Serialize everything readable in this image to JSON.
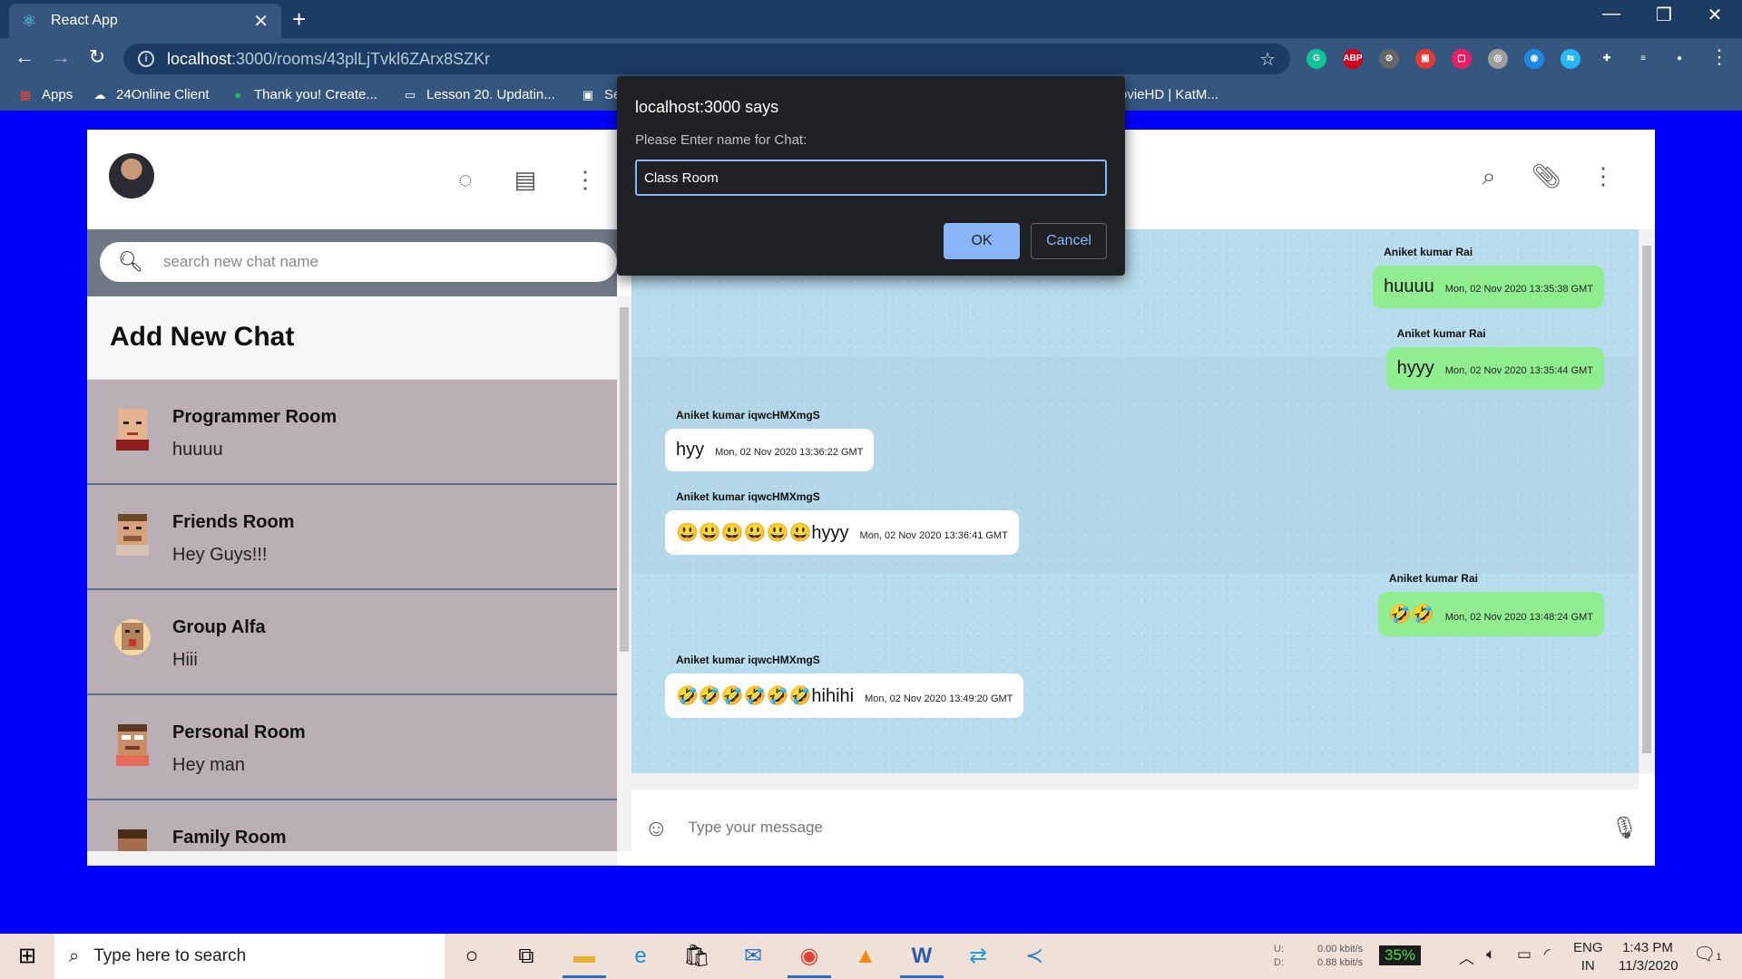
{
  "browser": {
    "tab_title": "React App",
    "url_host": "localhost",
    "url_path": ":3000/rooms/43plLjTvkl6ZArx8SZKr",
    "extensions": [
      "grammarly-icon",
      "adblock-icon",
      "blocker-icon",
      "extension-red-icon",
      "extension-pink-icon",
      "extension-gray-icon",
      "extension-blue-icon",
      "translate-icon",
      "puzzle-icon",
      "reading-list-icon",
      "profile-avatar-icon"
    ],
    "bookmarks": [
      "Apps",
      "24Online Client",
      "Thank you! Create...",
      "Lesson 20. Updatin...",
      "Se",
      "ovieHD | KatM..."
    ]
  },
  "sidebar": {
    "search_placeholder": "search new chat name",
    "add_new_chat": "Add New Chat",
    "rooms": [
      {
        "name": "Programmer Room",
        "last": "huuuu",
        "color": "#e3b48f"
      },
      {
        "name": "Friends Room",
        "last": "Hey Guys!!!",
        "color": "#d9a07c"
      },
      {
        "name": "Group Alfa",
        "last": "Hiii",
        "color": "#b5835f"
      },
      {
        "name": "Personal Room",
        "last": "Hey man",
        "color": "#c98e66"
      },
      {
        "name": "Family Room",
        "last": "",
        "color": "#a56d4c"
      }
    ]
  },
  "chat": {
    "messages": [
      {
        "sender": "Aniket kumar Rai",
        "text": "huuuu",
        "time": "Mon, 02 Nov 2020 13:35:38 GMT",
        "mine": true
      },
      {
        "sender": "Aniket kumar Rai",
        "text": "hyyy",
        "time": "Mon, 02 Nov 2020 13:35:44 GMT",
        "mine": true
      },
      {
        "sender": "Aniket kumar iqwcHMXmgS",
        "text": "hyy",
        "time": "Mon, 02 Nov 2020 13:36:22 GMT",
        "mine": false
      },
      {
        "sender": "Aniket kumar iqwcHMXmgS",
        "text": "😃😃😃😃😃😃hyyy",
        "time": "Mon, 02 Nov 2020 13:36:41 GMT",
        "mine": false
      },
      {
        "sender": "Aniket kumar Rai",
        "text": "🤣🤣",
        "time": "Mon, 02 Nov 2020 13:48:24 GMT",
        "mine": true
      },
      {
        "sender": "Aniket kumar iqwcHMXmgS",
        "text": "🤣🤣🤣🤣🤣🤣hihihi",
        "time": "Mon, 02 Nov 2020 13:49:20 GMT",
        "mine": false
      }
    ],
    "input_placeholder": "Type your message"
  },
  "dialog": {
    "title": "localhost:3000 says",
    "message": "Please Enter name for Chat:",
    "value": "Class Room",
    "ok": "OK",
    "cancel": "Cancel"
  },
  "taskbar": {
    "search_placeholder": "Type here to search",
    "net_up_label": "U:",
    "net_down_label": "D:",
    "net_up": "0.00 kbit/s",
    "net_down": "0.88 kbit/s",
    "battery": "35%",
    "lang": "ENG",
    "region": "IN",
    "time": "1:43 PM",
    "date": "11/3/2020",
    "notifications": "1"
  }
}
